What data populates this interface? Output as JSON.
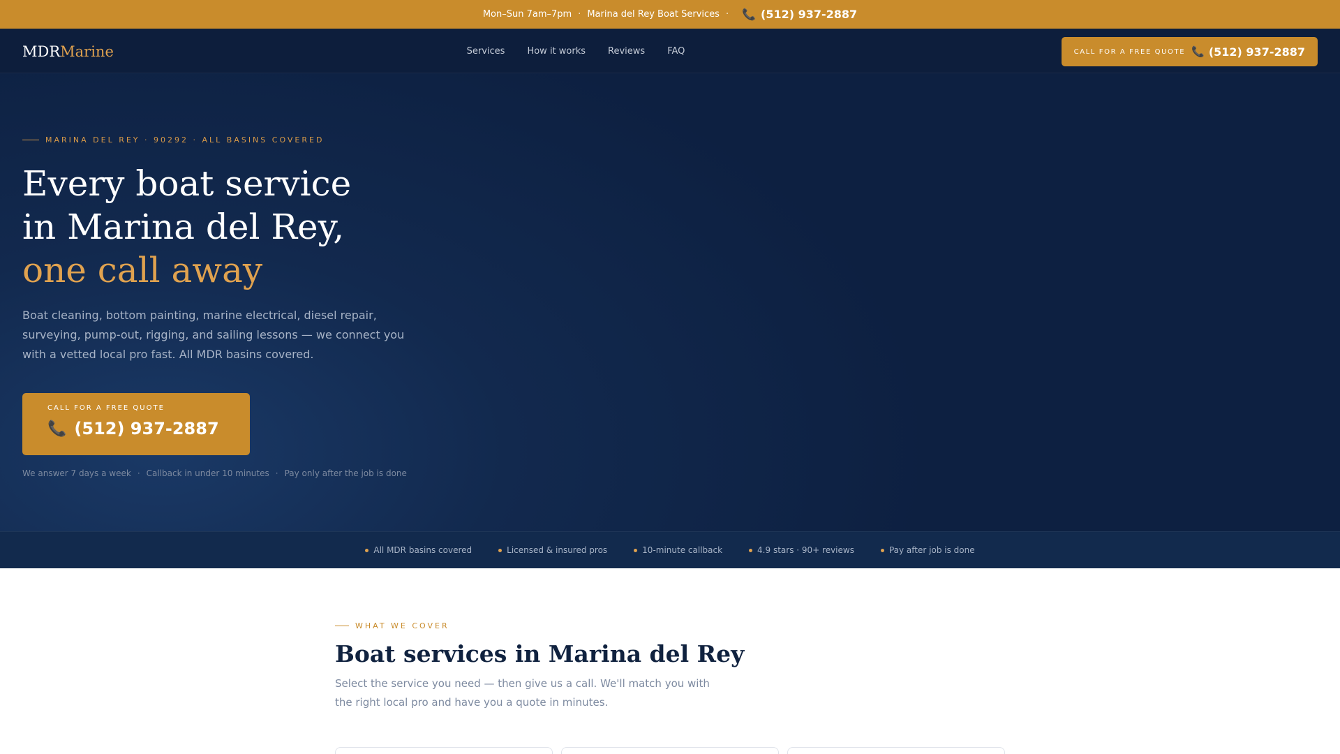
{
  "topbar": {
    "hours": "Mon–Sun 7am–7pm",
    "sep": "·",
    "business": "Marina del Rey Boat Services",
    "phone_icon": "phone-icon",
    "phone": "(512) 937-2887"
  },
  "nav": {
    "logo_main": "MDR",
    "logo_accent": "Marine",
    "links": [
      "Services",
      "How it works",
      "Reviews",
      "FAQ"
    ],
    "cta_label": "CALL FOR A FREE QUOTE",
    "cta_phone": "(512) 937-2887"
  },
  "hero": {
    "eyebrow": "MARINA DEL REY · 90292 · ALL BASINS COVERED",
    "headline_line1": "Every boat service",
    "headline_line2": "in Marina del Rey,",
    "headline_accent": "one call away",
    "description": "Boat cleaning, bottom painting, marine electrical, diesel repair, surveying, pump-out, rigging, and sailing lessons — we connect you with a vetted local pro fast. All MDR basins covered.",
    "cta_label": "CALL FOR A FREE QUOTE",
    "cta_phone": "(512) 937-2887",
    "reassurance": [
      "We answer 7 days a week",
      "Callback in under 10 minutes",
      "Pay only after the job is done"
    ]
  },
  "trust": [
    "All MDR basins covered",
    "Licensed & insured pros",
    "10-minute callback",
    "4.9 stars · 90+ reviews",
    "Pay after job is done"
  ],
  "services": {
    "eyebrow": "WHAT WE COVER",
    "title": "Boat services in Marina del Rey",
    "description": "Select the service you need — then give us a call. We'll match you with the right local pro and have you a quote in minutes."
  },
  "colors": {
    "accent": "#c98c2c",
    "navy": "#0d1e3c",
    "gold_text": "#e0a24f"
  }
}
